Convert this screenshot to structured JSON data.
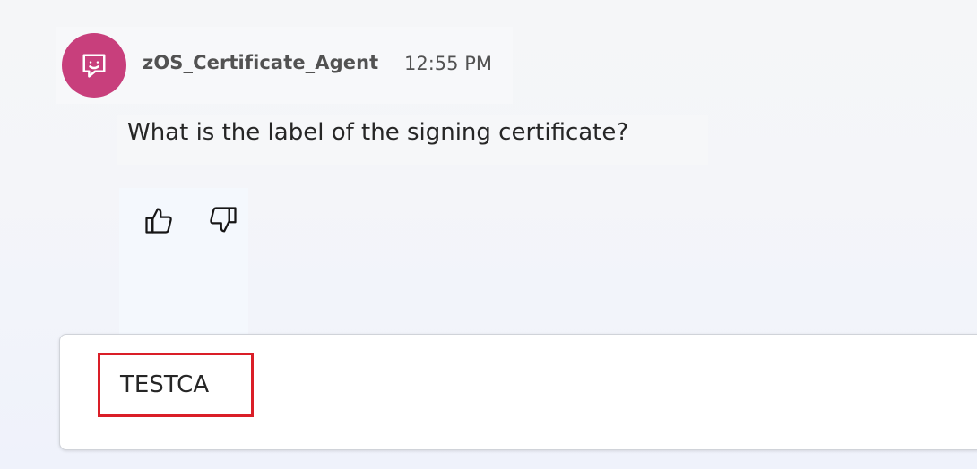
{
  "message": {
    "agent_name": "zOS_Certificate_Agent",
    "timestamp": "12:55 PM",
    "text": "What is the label of the signing certificate?",
    "avatar_icon": "chat-bot-icon"
  },
  "feedback": {
    "like_icon": "thumbs-up-icon",
    "dislike_icon": "thumbs-down-icon"
  },
  "input": {
    "value": "TESTCA"
  },
  "colors": {
    "avatar_bg": "#c83f7c",
    "highlight_border": "#da1e28"
  }
}
